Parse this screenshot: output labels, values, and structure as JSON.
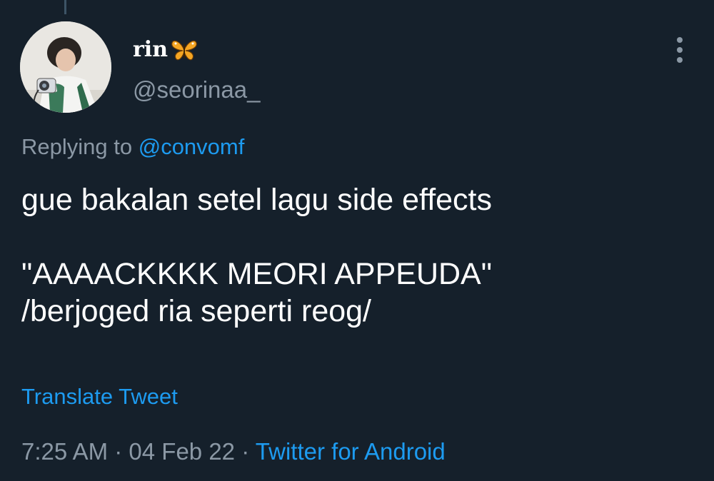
{
  "tweet": {
    "author": {
      "display_name": "rin",
      "name_emoji": "butterfly-icon",
      "handle": "@seorinaa_"
    },
    "replying_to": {
      "prefix": "Replying to",
      "mention": "@convomf"
    },
    "text": "gue bakalan setel lagu side effects\n\n\"AAAACKKKK MEORI APPEUDA\"\n/berjoged ria seperti reog/",
    "translate_label": "Translate Tweet",
    "time": "7:25 AM",
    "separator": "·",
    "date": "04 Feb 22",
    "source": "Twitter for Android",
    "more_icon": "more-vertical-icon"
  },
  "colors": {
    "background": "#15202b",
    "primary_text": "#ffffff",
    "secondary_text": "#8b98a5",
    "accent": "#1d9bf0",
    "butterfly": "#f5a623"
  }
}
